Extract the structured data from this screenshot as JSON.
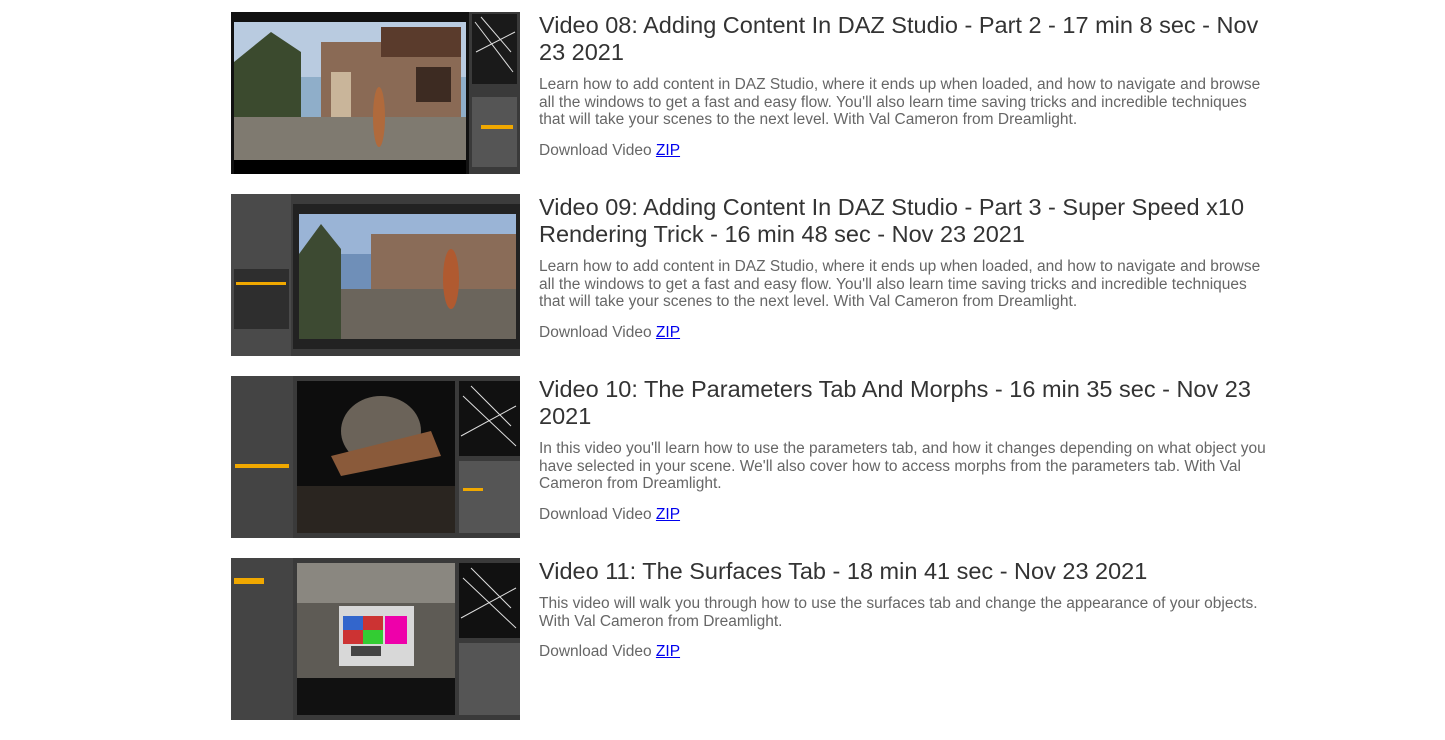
{
  "videos": [
    {
      "title": "Video 08: Adding Content In DAZ Studio - Part 2 - 17 min 8 sec - Nov 23 2021",
      "description": "Learn how to add content in DAZ Studio, where it ends up when loaded, and how to navigate and browse all the windows to get a fast and easy flow. You'll also learn time saving tricks and incredible techniques that will take your scenes to the next level. With Val Cameron from Dreamlight.",
      "download_label": "Download Video",
      "link_label": "ZIP"
    },
    {
      "title": "Video 09: Adding Content In DAZ Studio - Part 3 - Super Speed x10 Rendering Trick - 16 min 48 sec - Nov 23 2021",
      "description": "Learn how to add content in DAZ Studio, where it ends up when loaded, and how to navigate and browse all the windows to get a fast and easy flow. You'll also learn time saving tricks and incredible techniques that will take your scenes to the next level. With Val Cameron from Dreamlight.",
      "download_label": "Download Video",
      "link_label": "ZIP"
    },
    {
      "title": "Video 10: The Parameters Tab And Morphs - 16 min 35 sec - Nov 23 2021",
      "description": "In this video you'll learn how to use the parameters tab, and how it changes depending on what object you have selected in your scene. We'll also cover how to access morphs from the parameters tab. With Val Cameron from Dreamlight.",
      "download_label": "Download Video",
      "link_label": "ZIP"
    },
    {
      "title": "Video 11: The Surfaces Tab - 18 min 41 sec - Nov 23 2021",
      "description": "This video will walk you through how to use the surfaces tab and change the appearance of your objects. With Val Cameron from Dreamlight.",
      "download_label": "Download Video",
      "link_label": "ZIP"
    }
  ]
}
